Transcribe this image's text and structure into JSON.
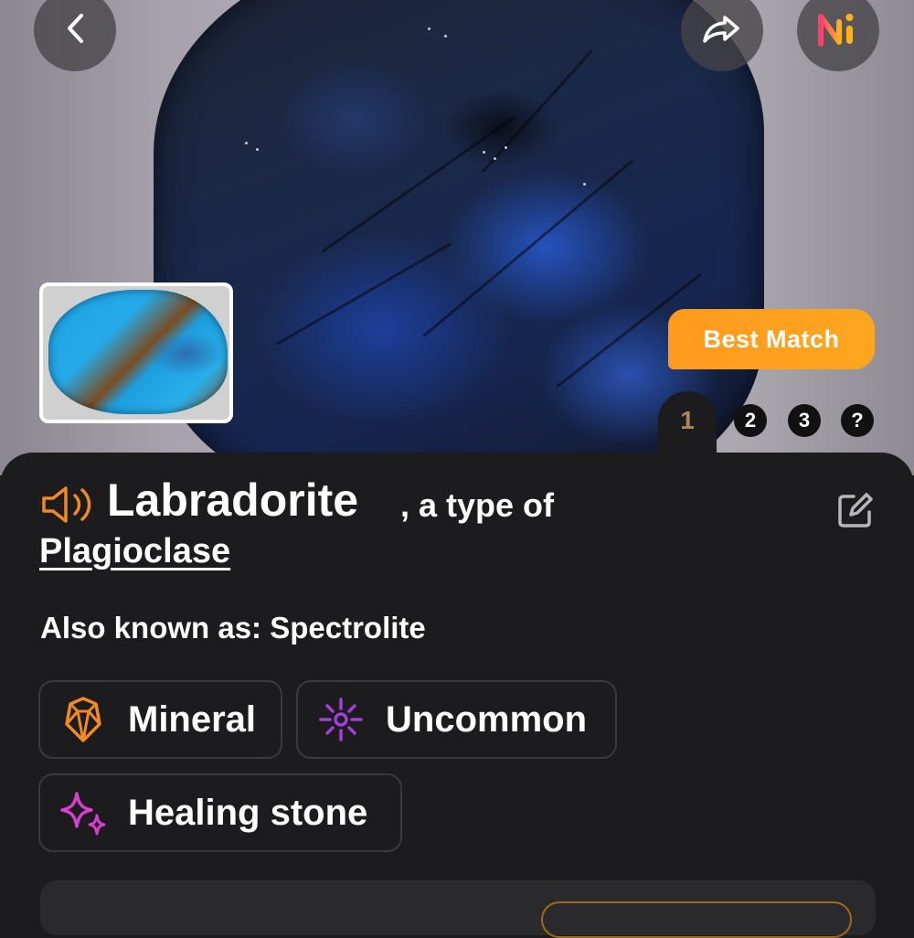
{
  "header": {
    "back_icon": "chevron-left-icon",
    "share_icon": "share-icon",
    "app_logo_icon": "ai-logo-icon"
  },
  "photo": {
    "badge": "Best Match",
    "pager": [
      "1",
      "2",
      "3",
      "?"
    ],
    "active_page": "1"
  },
  "result": {
    "name": "Labradorite",
    "type_prefix": ", a type of",
    "genus": "Plagioclase",
    "also_known_as_label": "Also known as:",
    "also_known_as_value": "Spectrolite",
    "tags": [
      {
        "label": "Mineral",
        "icon": "crystal-icon",
        "color": "#f08a24"
      },
      {
        "label": "Uncommon",
        "icon": "sparkle-burst-icon",
        "color": "#a23fd6"
      },
      {
        "label": "Healing stone",
        "icon": "sparkles-icon",
        "color": "#d63fd0"
      }
    ]
  },
  "colors": {
    "accent_orange": "#ffa61f",
    "sheet_bg": "#1c1b1d"
  }
}
